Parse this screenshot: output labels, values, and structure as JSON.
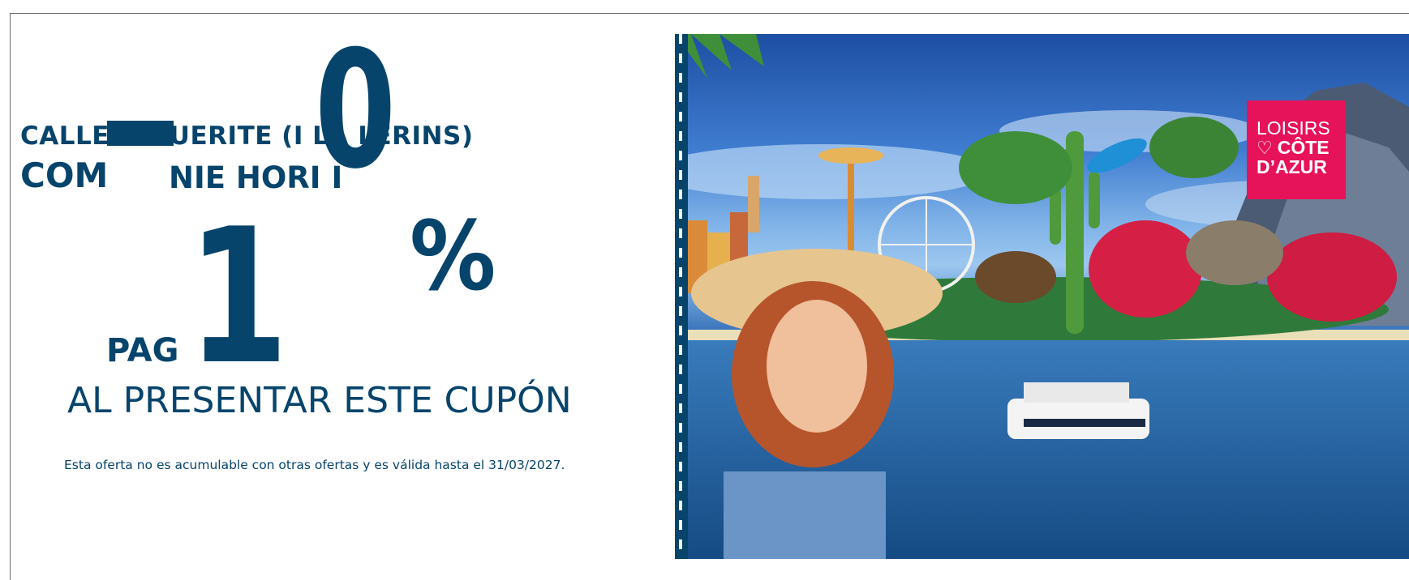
{
  "coupon": {
    "address_line": "CALLE.  RGUERITE (I  LA   LÉRINS)",
    "company_line_left": "COM",
    "company_line_right": "NIE HORI   I",
    "discount_digit_top": "0",
    "discount_digit_main": "1",
    "percent_sign": "%",
    "pay_label": "PAG",
    "present_text": "AL PRESENTAR ESTE CUPÓN",
    "fine_print": "Esta oferta no es acumulable con otras ofertas y es válida hasta el 31/03/2027."
  },
  "logo": {
    "line1": "LOISIRS",
    "line2": "CÔTE",
    "line3": "D’AZUR",
    "heart_icon": "heart-outline-icon",
    "color": "#e6135a"
  },
  "colors": {
    "brand_text": "#06446c",
    "border": "#6b6b6b"
  }
}
